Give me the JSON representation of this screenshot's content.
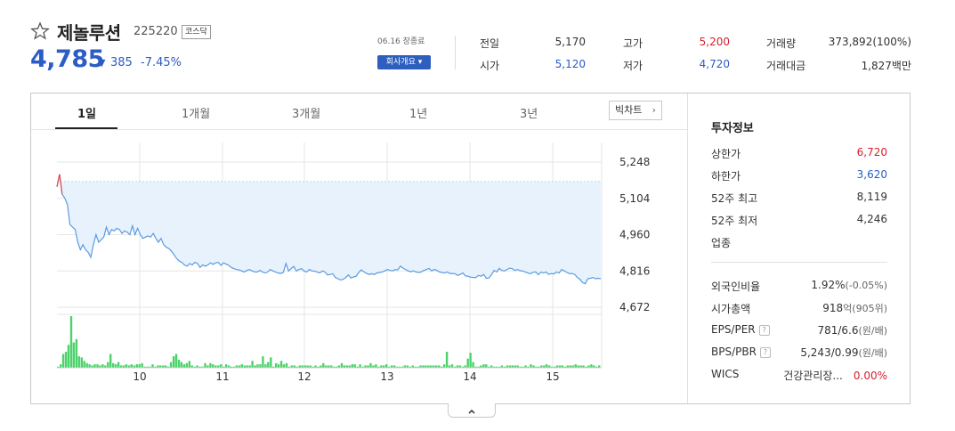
{
  "stock": {
    "name": "제놀루션",
    "code": "225220",
    "market": "코스닥",
    "price": "4,785",
    "change_arrow": "▼",
    "change_amount": "385",
    "change_percent": "-7.45%",
    "date_note": "06.16 장종료",
    "company_button": "회사개요 ▾"
  },
  "summary": {
    "prev_close": {
      "label": "전일",
      "value": "5,170"
    },
    "open": {
      "label": "시가",
      "value": "5,120"
    },
    "high": {
      "label": "고가",
      "value": "5,200"
    },
    "low": {
      "label": "저가",
      "value": "4,720"
    },
    "volume": {
      "label": "거래량",
      "value": "373,892(100%)"
    },
    "amount": {
      "label": "거래대금",
      "value": "1,827백만"
    }
  },
  "tabs": [
    {
      "label": "1일",
      "active": true
    },
    {
      "label": "1개월",
      "active": false
    },
    {
      "label": "3개월",
      "active": false
    },
    {
      "label": "1년",
      "active": false
    },
    {
      "label": "3년",
      "active": false
    }
  ],
  "big_chart_button": "빅차트",
  "chart_data": {
    "type": "line",
    "title": "",
    "y_ticks": [
      "5,248",
      "5,104",
      "4,960",
      "4,816",
      "4,672"
    ],
    "ylim": [
      4672,
      5248
    ],
    "prev_close_line": 5170,
    "x_ticks": [
      "10",
      "11",
      "12",
      "13",
      "14",
      "15"
    ],
    "series": [
      {
        "values": [
          5150,
          5200,
          5120,
          5105,
          5080,
          5000,
          4990,
          4980,
          4930,
          4900,
          4920,
          4900,
          4890,
          4870,
          4920,
          4960,
          4930,
          4940,
          4950,
          4990,
          4960,
          4980,
          4975,
          4985,
          4980,
          4965,
          4975,
          4970,
          4960,
          4995,
          4960,
          4985,
          4960,
          4945,
          4950,
          4955,
          4950,
          4965,
          4945,
          4930,
          4945,
          4920,
          4910,
          4905,
          4895,
          4880,
          4865,
          4855,
          4850,
          4840,
          4835,
          4845,
          4840,
          4850,
          4845,
          4830,
          4840,
          4835,
          4840,
          4848,
          4842,
          4848,
          4850,
          4838,
          4848,
          4843,
          4838,
          4830,
          4825,
          4822,
          4820,
          4816,
          4812,
          4818,
          4822,
          4816,
          4812,
          4812,
          4818,
          4812,
          4808,
          4812,
          4822,
          4816,
          4812,
          4808,
          4806,
          4810,
          4846,
          4816,
          4825,
          4834,
          4816,
          4822,
          4825,
          4816,
          4812,
          4822,
          4816,
          4815,
          4812,
          4808,
          4816,
          4812,
          4800,
          4802,
          4805,
          4790,
          4785,
          4780,
          4783,
          4790,
          4800,
          4788,
          4792,
          4795,
          4810,
          4820,
          4812,
          4806,
          4802,
          4805,
          4802,
          4808,
          4810,
          4812,
          4816,
          4822,
          4818,
          4816,
          4822,
          4820,
          4835,
          4827,
          4822,
          4816,
          4813,
          4816,
          4812,
          4810,
          4812,
          4818,
          4822,
          4826,
          4816,
          4822,
          4818,
          4812,
          4810,
          4808,
          4812,
          4806,
          4806,
          4805,
          4798,
          4802,
          4808,
          4796,
          4795,
          4791,
          4790,
          4790,
          4798,
          4795,
          4802,
          4787,
          4788,
          4801,
          4818,
          4812,
          4826,
          4818,
          4816,
          4822,
          4827,
          4825,
          4818,
          4822,
          4817,
          4816,
          4812,
          4808,
          4805,
          4811,
          4812,
          4801,
          4812,
          4808,
          4812,
          4802,
          4806,
          4804,
          4812,
          4808,
          4822,
          4816,
          4810,
          4805,
          4806,
          4802,
          4790,
          4783,
          4770,
          4765,
          4785,
          4787,
          4790,
          4785,
          4787,
          4785
        ]
      }
    ],
    "volume": [
      1,
      3,
      12,
      14,
      20,
      45,
      22,
      25,
      10,
      9,
      6,
      4,
      3,
      2,
      3,
      3,
      2,
      3,
      2,
      5,
      12,
      4,
      3,
      5,
      2,
      2,
      3,
      2,
      3,
      2,
      3,
      3,
      4,
      1,
      1,
      1,
      3,
      1,
      2,
      2,
      2,
      2,
      1,
      5,
      10,
      12,
      7,
      5,
      3,
      4,
      6,
      2,
      1,
      2,
      1,
      1,
      4,
      2,
      4,
      3,
      2,
      2,
      3,
      1,
      3,
      2,
      1,
      1,
      2,
      2,
      3,
      2,
      2,
      2,
      6,
      2,
      3,
      3,
      10,
      3,
      5,
      9,
      1,
      4,
      3,
      6,
      3,
      4,
      1,
      2,
      2,
      1,
      2,
      2,
      2,
      2,
      2,
      1,
      2,
      1,
      2,
      4,
      2,
      2,
      2,
      1,
      1,
      2,
      4,
      2,
      2,
      2,
      3,
      3,
      1,
      3,
      1,
      2,
      2,
      4,
      2,
      3,
      1,
      2,
      2,
      3,
      1,
      2,
      2,
      1,
      1,
      1,
      2,
      2,
      1,
      2,
      1,
      1,
      2,
      2,
      2,
      2,
      2,
      2,
      2,
      2,
      1,
      3,
      14,
      2,
      3,
      1,
      2,
      2,
      1,
      2,
      8,
      13,
      5,
      1,
      1,
      2,
      3,
      3,
      1,
      2,
      1,
      1,
      1,
      2,
      1,
      2,
      2,
      2,
      2,
      2,
      1,
      1,
      2,
      1,
      3,
      2,
      1,
      1,
      2,
      2,
      3,
      2,
      1,
      1,
      2,
      2,
      2,
      1,
      2,
      2,
      2,
      3,
      2,
      2,
      2,
      1,
      2,
      3,
      2,
      1,
      2
    ]
  },
  "invest_info": {
    "title": "투자정보",
    "rows_top": [
      {
        "label": "상한가",
        "value": "6,720",
        "color": "red"
      },
      {
        "label": "하한가",
        "value": "3,620",
        "color": "blue"
      },
      {
        "label": "52주 최고",
        "value": "8,119",
        "color": ""
      },
      {
        "label": "52주 최저",
        "value": "4,246",
        "color": ""
      },
      {
        "label": "업종",
        "value": "",
        "color": ""
      }
    ],
    "rows_bottom": [
      {
        "label": "외국인비율",
        "value": "1.92%",
        "sub": "(-0.05%)"
      },
      {
        "label": "시가총액",
        "value": "918",
        "sub": "억(905위)"
      },
      {
        "label": "EPS/PER",
        "value": "781/6.6",
        "sub": "(원/배)"
      },
      {
        "label": "BPS/PBR",
        "value": "5,243/0.99",
        "sub": "(원/배)"
      },
      {
        "label": "WICS",
        "value": "건강관리장...",
        "sub": "0.00%"
      }
    ]
  },
  "colors": {
    "price_down": "#2c5cc5",
    "price_up": "#d6202b",
    "line": "#5b9be0",
    "area_fill": "#e8f2fd",
    "volume_bar": "#4cd26b"
  }
}
